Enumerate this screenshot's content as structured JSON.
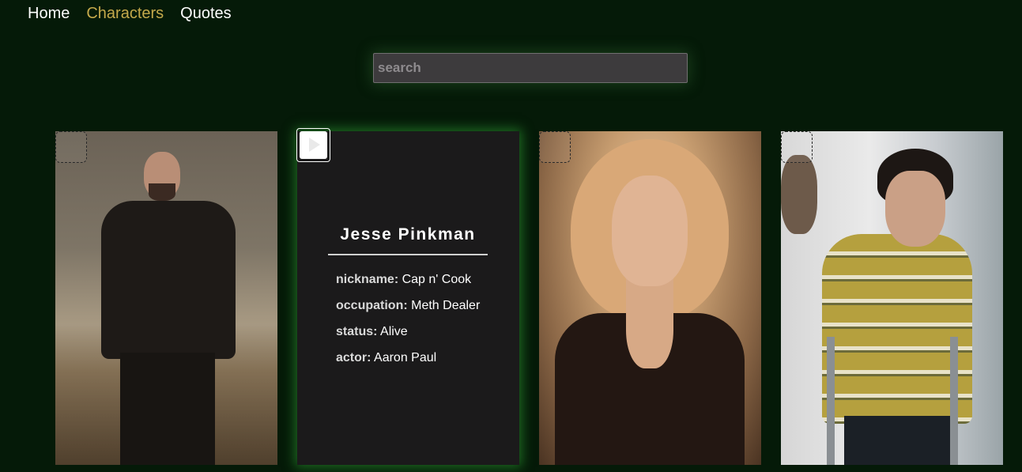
{
  "nav": {
    "items": [
      {
        "label": "Home",
        "active": false
      },
      {
        "label": "Characters",
        "active": true
      },
      {
        "label": "Quotes",
        "active": false
      }
    ],
    "active_color": "#c4a94b"
  },
  "search": {
    "placeholder": "search",
    "value": ""
  },
  "cards": [
    {
      "kind": "photo",
      "subject": "Walter White portrait"
    },
    {
      "kind": "info",
      "name": "Jesse Pinkman",
      "facts": [
        {
          "label": "nickname:",
          "value": "Cap n' Cook"
        },
        {
          "label": "occupation:",
          "value": "Meth Dealer"
        },
        {
          "label": "status:",
          "value": "Alive"
        },
        {
          "label": "actor:",
          "value": "Aaron Paul"
        }
      ]
    },
    {
      "kind": "photo",
      "subject": "Skyler White portrait"
    },
    {
      "kind": "photo",
      "subject": "Walter White Jr. portrait"
    }
  ],
  "colors": {
    "background": "#051a08",
    "card_glow": "#1e6a22",
    "card_bg": "#1b1a1b"
  }
}
